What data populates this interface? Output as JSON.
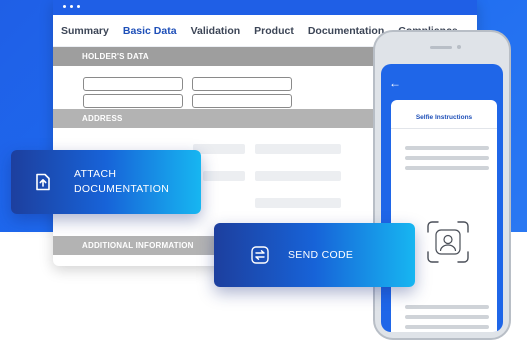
{
  "browser": {
    "tabs": [
      {
        "label": "Summary"
      },
      {
        "label": "Basic Data"
      },
      {
        "label": "Validation"
      },
      {
        "label": "Product"
      },
      {
        "label": "Documentation"
      },
      {
        "label": "Compliance"
      }
    ],
    "sections": {
      "holder": "HOLDER'S DATA",
      "address": "ADDRESS",
      "additional": "ADDITIONAL INFORMATION"
    }
  },
  "cards": {
    "attach": {
      "label": "ATTACH DOCUMENTATION",
      "icon": "upload-document-icon"
    },
    "send": {
      "label": "SEND CODE",
      "icon": "swap-arrows-icon"
    }
  },
  "phone": {
    "screen_title": "Selfie Instructions",
    "back_icon": "back-arrow-icon",
    "face_icon": "face-scan-icon"
  },
  "colors": {
    "brand_blue": "#1f5fe6",
    "active_tab": "#1e4fb8",
    "card_gradient_start": "#1d3f9e",
    "card_gradient_end": "#17b6f1"
  }
}
